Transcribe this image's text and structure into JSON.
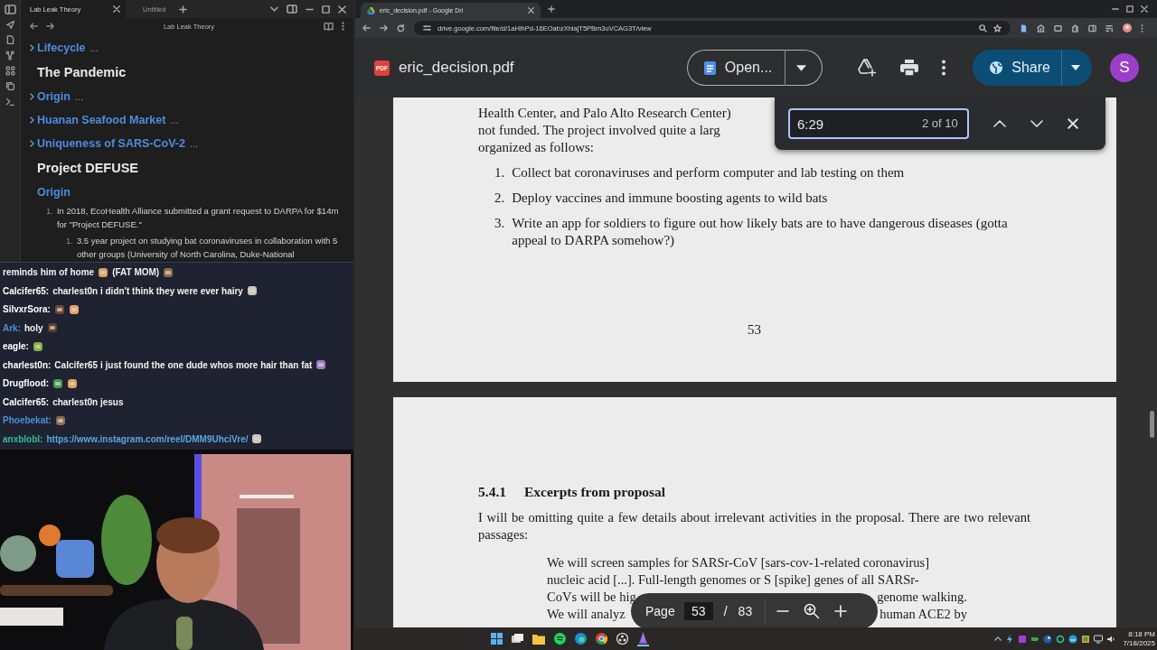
{
  "notes_app": {
    "tabs": [
      {
        "label": "Lab Leak Theory",
        "selected": true
      },
      {
        "label": "Untitled",
        "selected": false
      }
    ],
    "title": "Lab Leak Theory",
    "blocks": [
      {
        "kind": "h3",
        "text": "Lifecycle",
        "collapsed": true,
        "fold_marker": "..."
      },
      {
        "kind": "h2",
        "text": "The Pandemic"
      },
      {
        "kind": "h3",
        "text": "Origin",
        "collapsed": true,
        "fold_marker": "..."
      },
      {
        "kind": "h3",
        "text": "Huanan Seafood Market",
        "collapsed": true,
        "fold_marker": "..."
      },
      {
        "kind": "h3",
        "text": "Uniqueness of SARS-CoV-2",
        "collapsed": true,
        "fold_marker": "..."
      },
      {
        "kind": "h2",
        "text": "Project DEFUSE"
      },
      {
        "kind": "h3",
        "text": "Origin",
        "collapsed": false
      },
      {
        "kind": "list",
        "items": [
          {
            "number": "1.",
            "text": "In 2018, EcoHealth Alliance submitted a grant request to DARPA for $14m for \"Project DEFUSE.\"",
            "children": [
              {
                "number": "1.",
                "text": "3.5 year project on studying bat coronaviruses in collaboration with 5 other groups (University of North Carolina, Duke-National"
              }
            ]
          }
        ]
      }
    ]
  },
  "chat": {
    "messages": [
      {
        "parts": [
          {
            "kind": "text",
            "text": "reminds him of home"
          },
          {
            "kind": "emote"
          },
          {
            "kind": "text",
            "text": "(FAT MOM)"
          },
          {
            "kind": "emote"
          }
        ]
      },
      {
        "user": "Calcifer65:",
        "color": "#ffffff",
        "parts": [
          {
            "kind": "text",
            "text": "charlest0n i didn't think they were ever hairy"
          },
          {
            "kind": "emote"
          }
        ]
      },
      {
        "user": "SilvxrSora:",
        "color": "#ffffff",
        "parts": [
          {
            "kind": "emote"
          },
          {
            "kind": "emote"
          }
        ]
      },
      {
        "user": "Ark:",
        "color": "#4a8fd6",
        "parts": [
          {
            "kind": "text",
            "text": "holy"
          },
          {
            "kind": "emote"
          }
        ]
      },
      {
        "user": "eagle:",
        "color": "#ffffff",
        "parts": [
          {
            "kind": "emote"
          }
        ]
      },
      {
        "user": "charlest0n:",
        "color": "#ffffff",
        "parts": [
          {
            "kind": "text",
            "text": "Calcifer65 i just found the one dude whos more hair than fat"
          },
          {
            "kind": "emote"
          }
        ]
      },
      {
        "user": "Drugflood:",
        "color": "#ffffff",
        "parts": [
          {
            "kind": "emote"
          },
          {
            "kind": "emote"
          }
        ]
      },
      {
        "user": "Calcifer65:",
        "color": "#ffffff",
        "parts": [
          {
            "kind": "text",
            "text": "charlest0n jesus"
          }
        ]
      },
      {
        "user": "Phoebekat:",
        "color": "#4a8fd6",
        "parts": [
          {
            "kind": "emote"
          }
        ]
      },
      {
        "user": "anxblobl:",
        "color": "#2fbf9a",
        "parts": [
          {
            "kind": "link",
            "text": "https://www.instagram.com/reel/DMM9UhciVre/"
          },
          {
            "kind": "emote"
          }
        ]
      }
    ]
  },
  "browser": {
    "tab_title": "eric_decision.pdf - Google Dri",
    "url": "drive.google.com/file/d/1aHlhPd-16EOabzXhiajT5PBm3uVCAG3T/view"
  },
  "drive": {
    "file_badge": "PDF",
    "file_name": "eric_decision.pdf",
    "open_button": "Open...",
    "share_button": "Share",
    "avatar": "S"
  },
  "document": {
    "page_top": {
      "lines": [
        "Health Center, and Palo Alto Research Center)",
        "not funded.  The project involved quite a larg",
        "organized as follows:"
      ],
      "list": [
        {
          "number": "1.",
          "text": "Collect bat coronaviruses and perform computer and lab testing on them"
        },
        {
          "number": "2.",
          "text": "Deploy vaccines and immune boosting agents to wild bats"
        },
        {
          "number": "3.",
          "text": "Write an app for soldiers to figure out how likely bats are to have dangerous diseases (gotta appeal to DARPA somehow?)"
        }
      ],
      "page_number": "53"
    },
    "page_next": {
      "heading_number": "5.4.1",
      "heading": "Excerpts from proposal",
      "paragraph": "I will be omitting quite a few details about irrelevant activities in the proposal. There are two relevant passages:",
      "quote_lines": [
        {
          "segments": [
            "We will screen samples for SARSr-CoV [sars-cov-1-related coronavirus]"
          ]
        },
        {
          "segments": [
            "nucleic acid [...]. Full-length genomes or S [spike] genes of all SARSr-"
          ]
        },
        {
          "segments": [
            "CoVs will be hig",
            "genome walking."
          ]
        },
        {
          "segments": [
            "We will analyz",
            "human ACE2 by"
          ]
        }
      ]
    }
  },
  "find_bar": {
    "value": "6:29",
    "count": "2 of 10"
  },
  "page_controls": {
    "label": "Page",
    "current": "53",
    "separator": "/",
    "total": "83"
  },
  "taskbar": {
    "time": "8:18 PM",
    "date": "7/18/2025"
  }
}
